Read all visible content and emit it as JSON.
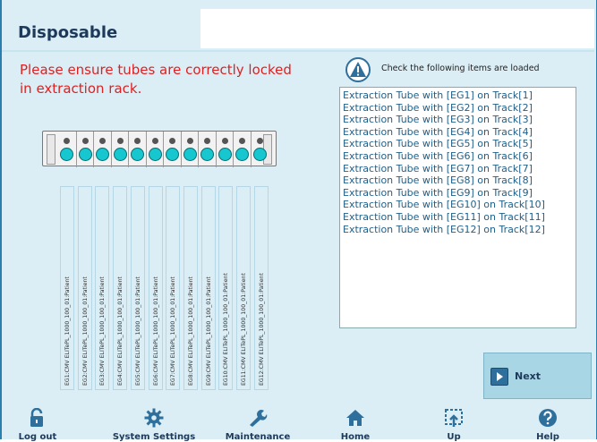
{
  "header": {
    "title": "Disposable"
  },
  "warning": {
    "text": "Please ensure tubes are correctly locked in extraction rack."
  },
  "check": {
    "heading": "Check the following items are loaded",
    "items": [
      "Extraction Tube with [EG1] on Track[1]",
      "Extraction Tube with [EG2] on Track[2]",
      "Extraction Tube with [EG3] on Track[3]",
      "Extraction Tube with [EG4] on Track[4]",
      "Extraction Tube with [EG5] on Track[5]",
      "Extraction Tube with [EG6] on Track[6]",
      "Extraction Tube with [EG7] on Track[7]",
      "Extraction Tube with [EG8] on Track[8]",
      "Extraction Tube with [EG9] on Track[9]",
      "Extraction Tube with [EG10] on Track[10]",
      "Extraction Tube with [EG11] on Track[11]",
      "Extraction Tube with [EG12] on Track[12]"
    ]
  },
  "strips": [
    "EG1:CMV ELITePL_1000_100_01:Patient",
    "EG2:CMV ELITePL_1000_100_01:Patient",
    "EG3:CMV ELITePL_1000_100_01:Patient",
    "EG4:CMV ELITePL_1000_100_01:Patient",
    "EG5:CMV ELITePL_1000_100_01:Patient",
    "EG6:CMV ELITePL_1000_100_01:Patient",
    "EG7:CMV ELITePL_1000_100_01:Patient",
    "EG8:CMV ELITePL_1000_100_01:Patient",
    "EG9:CMV ELITePL_1000_100_01:Patient",
    "EG10:CMV ELITePL_1000_100_01:Patient",
    "EG11:CMV ELITePL_1000_100_01:Patient",
    "EG12:CMV ELITePL_1000_100_01:Patient"
  ],
  "next_button": {
    "label": "Next"
  },
  "nav": [
    {
      "label": "Log out",
      "icon": "unlock-icon"
    },
    {
      "label": "System Settings",
      "icon": "gear-icon"
    },
    {
      "label": "Maintenance",
      "icon": "wrench-icon"
    },
    {
      "label": "Home",
      "icon": "home-icon"
    },
    {
      "label": "Up",
      "icon": "up-icon"
    },
    {
      "label": "Help",
      "icon": "help-icon"
    }
  ],
  "colors": {
    "accent": "#2a7fb0",
    "background": "#dbeef6",
    "warning": "#e02020",
    "tube": "#16c7cf",
    "list_text": "#1f5e88"
  }
}
